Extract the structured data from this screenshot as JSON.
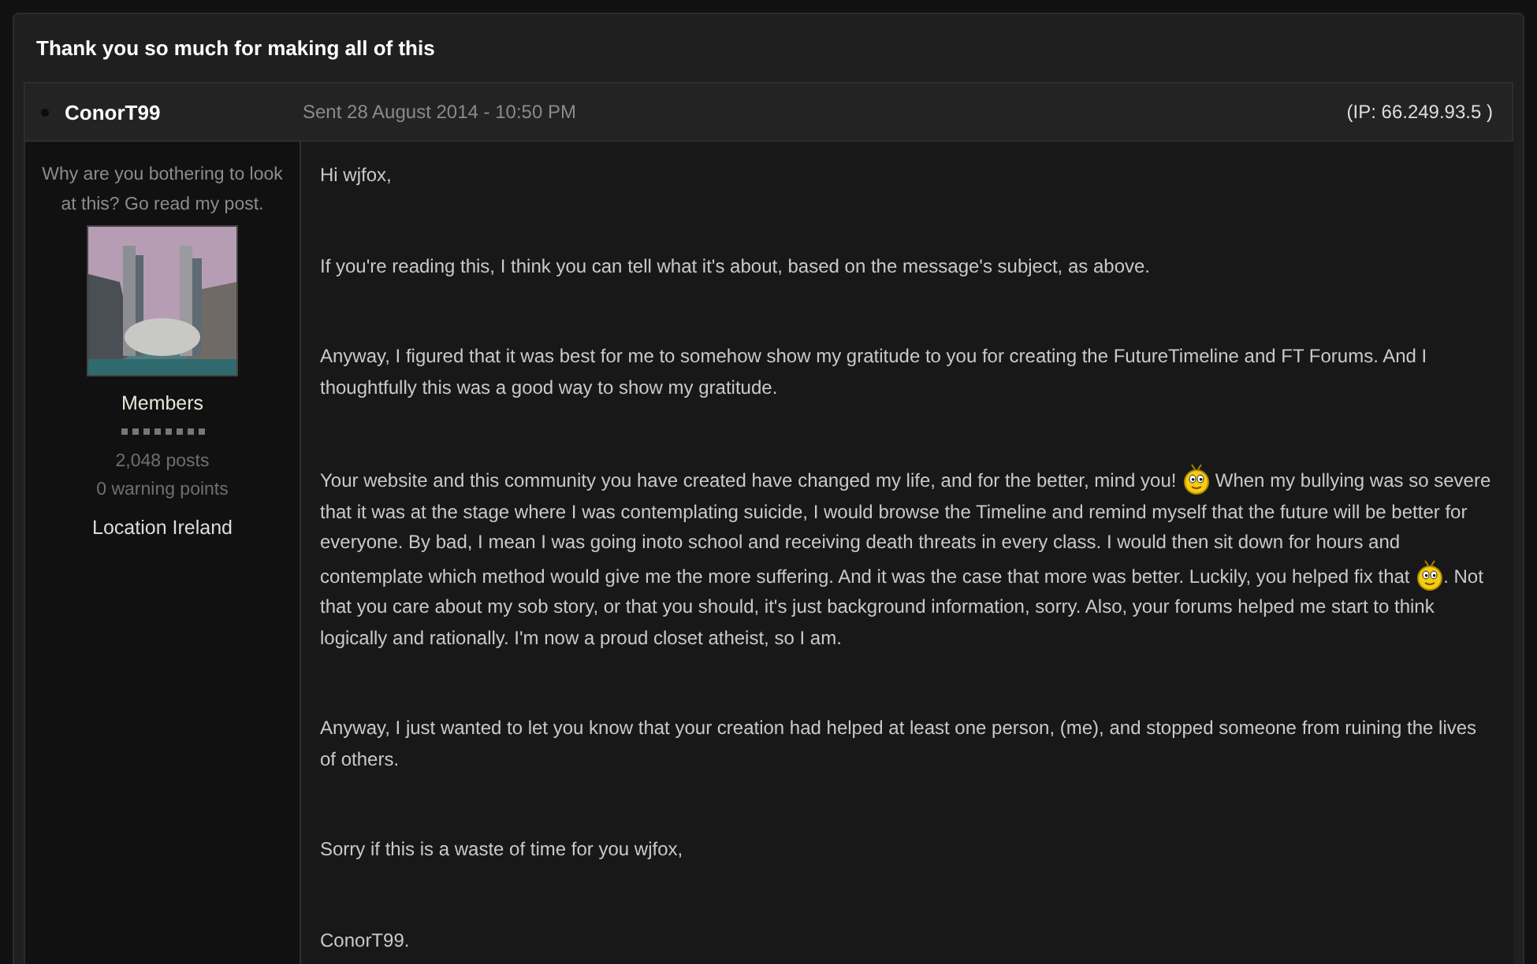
{
  "topic": {
    "title": "Thank you so much for making all of this"
  },
  "post": {
    "author": "ConorT99",
    "online": false,
    "sent": "Sent 28 August 2014 - 10:50 PM",
    "ip": "(IP: 66.249.93.5 )",
    "profile": {
      "tagline": "Why are you bothering to look at this? Go read my post.",
      "group": "Members",
      "posts": "2,048 posts",
      "warnings": "0 warning points",
      "location": "Location Ireland"
    },
    "paragraphs": [
      [
        {
          "kind": "text",
          "text": "Hi wjfox,"
        }
      ],
      [
        {
          "kind": "text",
          "text": "If you're reading this, I think you can tell what it's about, based on the message's subject, as above."
        }
      ],
      [
        {
          "kind": "text",
          "text": "Anyway, I figured that it was best for me to somehow show my gratitude to you for creating the FutureTimeline and FT Forums. And I thoughtfully this was a good way to show my gratitude."
        }
      ],
      [
        {
          "kind": "text",
          "text": "Your website and this community you have created have changed my life, and for the better, mind you! "
        },
        {
          "kind": "smiley"
        },
        {
          "kind": "text",
          "text": " When my bullying was so severe that it was at the stage where I was contemplating suicide, I would browse the Timeline and remind myself that the future will be better for everyone. By bad, I mean I was going inoto school and receiving death threats in every class. I would then sit down for hours and contemplate which method would give me the more suffering. And it was the case that more was better. Luckily, you helped fix that "
        },
        {
          "kind": "smiley"
        },
        {
          "kind": "text",
          "text": ". Not that you care about my sob story, or that you should, it's just background information, sorry. Also, your forums helped me start to think logically and rationally. I'm now a proud closet atheist, so I am."
        }
      ],
      [
        {
          "kind": "text",
          "text": "Anyway, I just wanted to let you know that your creation had helped at least one person, (me), and stopped someone from ruining the lives of others."
        }
      ],
      [
        {
          "kind": "text",
          "text": "Sorry if this is a waste of time for you wjfox,"
        }
      ],
      [
        {
          "kind": "text",
          "text": "ConorT99."
        }
      ]
    ]
  }
}
